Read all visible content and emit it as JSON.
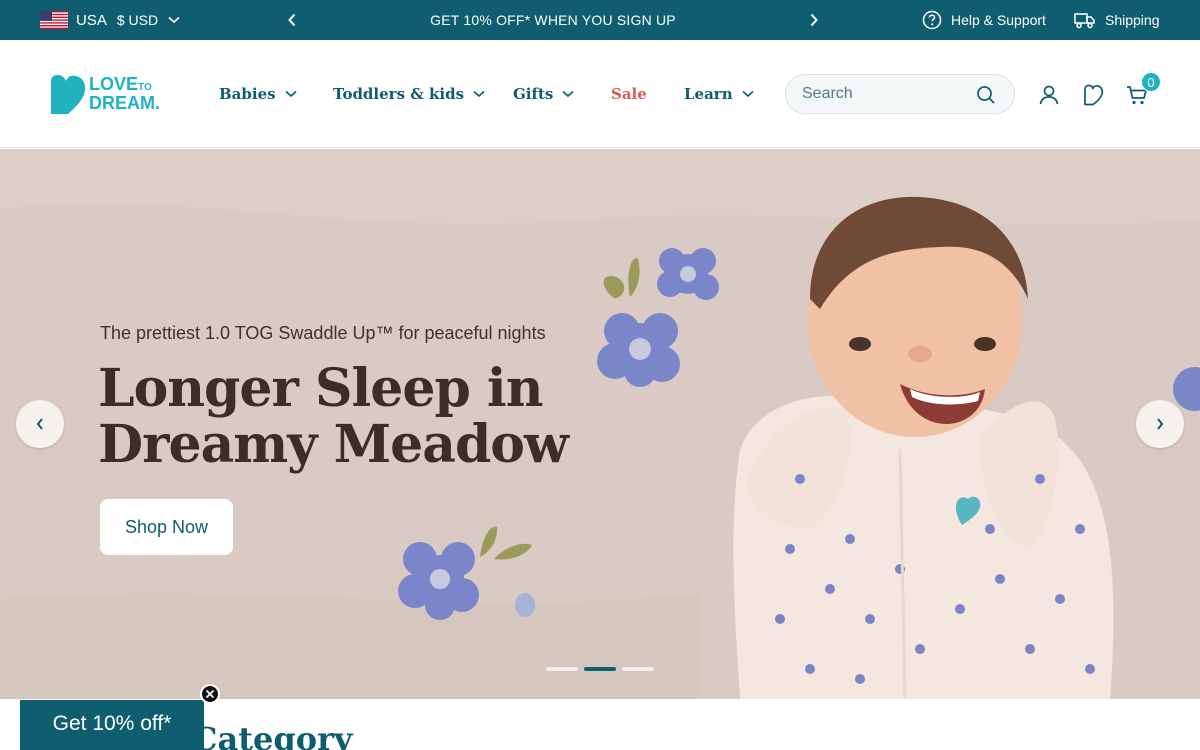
{
  "topbar": {
    "country": "USA",
    "currency": "$ USD",
    "promo": "GET 10% OFF* WHEN YOU SIGN UP",
    "help": "Help & Support",
    "shipping": "Shipping"
  },
  "header": {
    "logo": {
      "line1": "LOVE",
      "line1_small": "TO",
      "line2": "DREAM."
    },
    "nav": [
      {
        "label": "Babies"
      },
      {
        "label": "Toddlers & kids"
      },
      {
        "label": "Gifts"
      },
      {
        "label": "Sale"
      },
      {
        "label": "Learn"
      }
    ],
    "search": {
      "placeholder": "Search"
    },
    "cart_count": "0"
  },
  "hero": {
    "subtitle": "The prettiest 1.0 TOG Swaddle Up™ for peaceful nights",
    "title": "Longer Sleep in Dreamy Meadow",
    "cta": "Shop Now",
    "slides": 3,
    "active_slide": 2
  },
  "section": {
    "heading": "Category"
  },
  "popup": {
    "label": "Get 10% off*"
  },
  "colors": {
    "primary": "#0f5e70",
    "brand_teal": "#1fb3c0",
    "sale": "#d45f57",
    "hero_bg": "#d9cbc3",
    "hero_text": "#3a2f28"
  }
}
